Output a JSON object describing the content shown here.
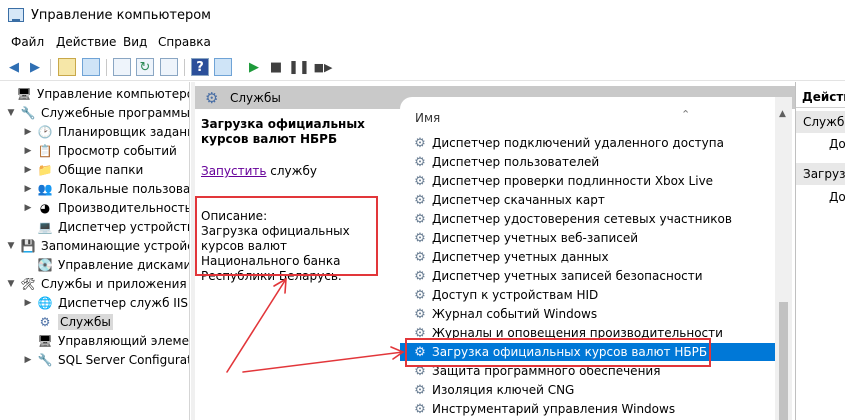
{
  "window": {
    "title": "Управление компьютером"
  },
  "menu": [
    "Файл",
    "Действие",
    "Вид",
    "Справка"
  ],
  "tree": [
    {
      "label": "Управление компьютером (л",
      "icon": "computer-management-icon"
    },
    {
      "label": "Служебные программы",
      "icon": "tools-icon"
    },
    {
      "label": "Планировщик заданий",
      "icon": "clock-icon"
    },
    {
      "label": "Просмотр событий",
      "icon": "event-viewer-icon"
    },
    {
      "label": "Общие папки",
      "icon": "shared-folder-icon"
    },
    {
      "label": "Локальные пользовате",
      "icon": "users-icon"
    },
    {
      "label": "Производительность",
      "icon": "performance-icon"
    },
    {
      "label": "Диспетчер устройств",
      "icon": "device-manager-icon"
    },
    {
      "label": "Запоминающие устройст",
      "icon": "storage-icon"
    },
    {
      "label": "Управление дисками",
      "icon": "disk-icon"
    },
    {
      "label": "Службы и приложения",
      "icon": "services-apps-icon"
    },
    {
      "label": "Диспетчер служб IIS",
      "icon": "iis-icon"
    },
    {
      "label": "Службы",
      "icon": "gear-icon"
    },
    {
      "label": "Управляющий элемен",
      "icon": "wmi-icon"
    },
    {
      "label": "SQL Server Configuratic",
      "icon": "sql-server-icon"
    }
  ],
  "services_header": {
    "title": "Службы"
  },
  "detail": {
    "title": "Загрузка официальных курсов валют НБРБ",
    "start_link": "Запустить",
    "start_suffix": " службу",
    "description_label": "Описание:",
    "description": "Загрузка официальных курсов валют Национального банка Республики Беларусь."
  },
  "list": {
    "column_name": "Имя",
    "rows": [
      "Диспетчер подключений удаленного доступа",
      "Диспетчер пользователей",
      "Диспетчер проверки подлинности Xbox Live",
      "Диспетчер скачанных карт",
      "Диспетчер удостоверения сетевых участников",
      "Диспетчер учетных веб-записей",
      "Диспетчер учетных данных",
      "Диспетчер учетных записей безопасности",
      "Доступ к устройствам HID",
      "Журнал событий Windows",
      "Журналы и оповещения производительности",
      "Загрузка официальных курсов валют НБРБ",
      "Защита программного обеспечения",
      "Изоляция ключей CNG",
      "Инструментарий управления Windows"
    ],
    "selected_index": 11
  },
  "actions": {
    "header": "Действ",
    "group1": "Служб",
    "item1": "Дог",
    "group2": "Загрузк",
    "item2": "Дог"
  },
  "colors": {
    "selection": "#0078d7",
    "highlight": "#e2363a",
    "link": "#660099"
  }
}
